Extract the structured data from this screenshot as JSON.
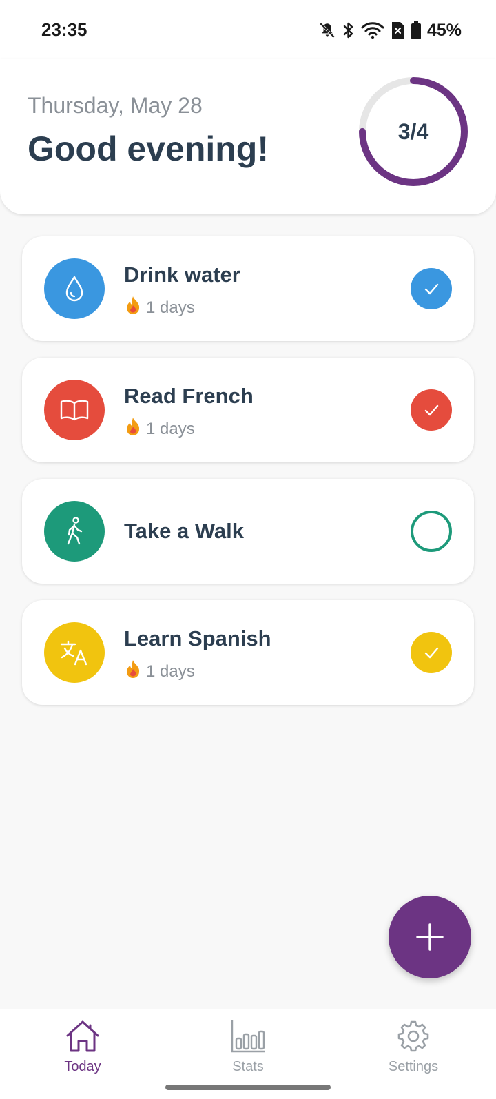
{
  "status_bar": {
    "time": "23:35",
    "battery": "45%",
    "icons": [
      "bell-off-icon",
      "bluetooth-icon",
      "wifi-icon",
      "sim-icon",
      "battery-icon"
    ]
  },
  "header": {
    "date": "Thursday, May 28",
    "greeting": "Good evening!",
    "progress_label": "3/4",
    "progress_fraction": 0.75,
    "accent_color": "#6c3483"
  },
  "habits": [
    {
      "name": "Drink water",
      "streak": "1 days",
      "icon": "water-drop-icon",
      "color": "#3a97e0",
      "completed": true
    },
    {
      "name": "Read French",
      "streak": "1 days",
      "icon": "book-icon",
      "color": "#e54c3d",
      "completed": true
    },
    {
      "name": "Take a Walk",
      "streak": "",
      "icon": "walking-icon",
      "color": "#1d9a7a",
      "completed": false
    },
    {
      "name": "Learn Spanish",
      "streak": "1 days",
      "icon": "translate-icon",
      "color": "#f1c40f",
      "completed": true
    }
  ],
  "fab": {
    "icon": "plus-icon",
    "color": "#6c3483"
  },
  "nav": {
    "today": "Today",
    "stats": "Stats",
    "settings": "Settings",
    "active": "today",
    "active_color": "#6c3483",
    "inactive_color": "#9aa0a6"
  }
}
